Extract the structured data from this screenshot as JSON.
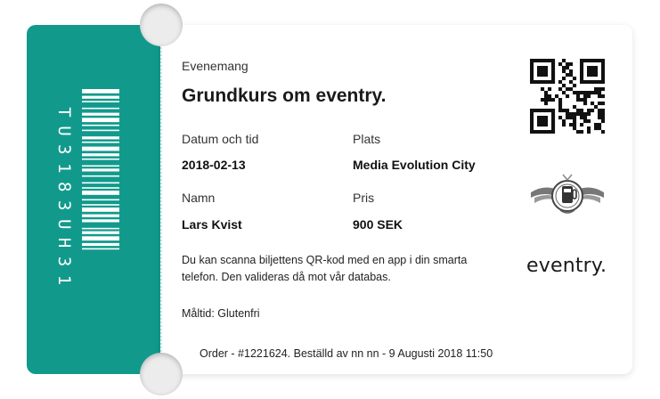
{
  "stub": {
    "code": "TU3183UH31",
    "color": "#119a8c"
  },
  "event": {
    "label": "Evenemang",
    "title": "Grundkurs om eventry."
  },
  "details": {
    "date_label": "Datum och tid",
    "date_value": "2018-02-13",
    "place_label": "Plats",
    "place_value": "Media Evolution City",
    "name_label": "Namn",
    "name_value": "Lars Kvist",
    "price_label": "Pris",
    "price_value": "900 SEK"
  },
  "note": "Du kan scanna biljettens QR-kod med en app i din smarta telefon. Den valideras då mot vår databas.",
  "meal": "Måltid: Glutenfri",
  "order": "Order - #1221624. Beställd av nn nn - 9 Augusti 2018 11:50",
  "brand": {
    "name": "eventry.",
    "qr_icon": "qr-code",
    "emblem_icon": "beer-emblem"
  }
}
